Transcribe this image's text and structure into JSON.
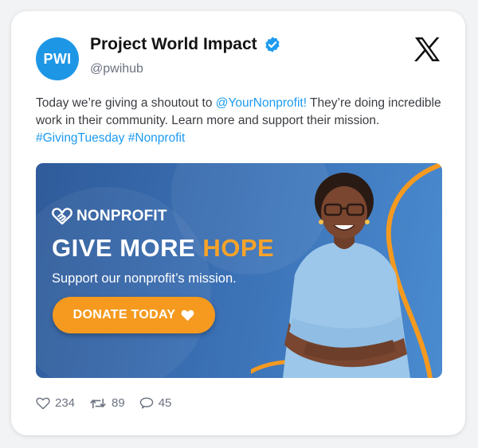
{
  "account": {
    "avatar_text": "PWI",
    "name": "Project World Impact",
    "handle": "@pwihub"
  },
  "tweet": {
    "text_1": "Today we’re giving a shoutout to ",
    "mention": "@YourNonprofit!",
    "text_2": " They’re doing incredible work in their community. Learn more and support their mission. ",
    "hashtag_1": "#GivingTuesday",
    "hashtag_2": "#Nonprofit"
  },
  "banner": {
    "brand": "NONPROFIT",
    "headline_main": "GIVE MORE ",
    "headline_accent": "HOPE",
    "subline": "Support our nonprofit’s mission.",
    "button_label": "DONATE TODAY"
  },
  "stats": {
    "likes": "234",
    "retweets": "89",
    "replies": "45"
  },
  "colors": {
    "accent": "#1d9bf0",
    "avatar_bg": "#1e96e6",
    "banner_bg": "#3a6fb3",
    "orange": "#f59a1f"
  },
  "icons": [
    "verified-badge-icon",
    "x-logo-icon",
    "handshake-heart-icon",
    "heart-icon",
    "retweet-icon",
    "reply-icon"
  ]
}
